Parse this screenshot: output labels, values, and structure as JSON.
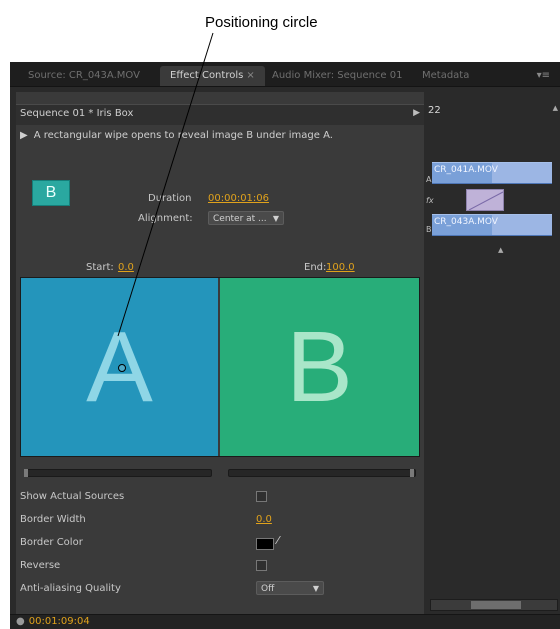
{
  "callout": {
    "label": "Positioning circle"
  },
  "tabs": [
    {
      "label": "Source: CR_043A.MOV"
    },
    {
      "label": "Effect Controls",
      "close": "×"
    },
    {
      "label": "Audio Mixer: Sequence 01"
    },
    {
      "label": "Metadata"
    }
  ],
  "tab_menu": "▾≡",
  "effect": {
    "sequence_title": "Sequence 01 * Iris Box",
    "description": "A rectangular wipe opens to reveal image B under image A.",
    "thumb_letter": "B",
    "duration_label": "Duration",
    "duration_value": "00:00:01:06",
    "alignment_label": "Alignment:",
    "alignment_value": "Center at ...",
    "start_label": "Start:",
    "start_value": "0.0",
    "end_label": "End:",
    "end_value": "100.0",
    "preview_a": "A",
    "preview_b": "B"
  },
  "properties": {
    "show_actual_sources": "Show Actual Sources",
    "border_width": "Border Width",
    "border_width_value": "0.0",
    "border_color": "Border Color",
    "reverse": "Reverse",
    "anti_aliasing": "Anti-aliasing Quality",
    "anti_aliasing_value": "Off"
  },
  "timeline": {
    "number": "22",
    "track_a": "A",
    "track_fx": "fx",
    "track_b": "B",
    "clip_a": "CR_041A.MOV",
    "clip_b": "CR_043A.MOV"
  },
  "status": {
    "timecode": "00:01:09:04"
  },
  "colors": {
    "accent": "#e0a21c",
    "preview_a": "#2495bb",
    "preview_b": "#28ad79",
    "clip": "#7aa0d8"
  },
  "icons": [
    "play-triangle-icon",
    "dropdown-caret-icon",
    "eyedropper-icon",
    "panel-menu-icon"
  ]
}
